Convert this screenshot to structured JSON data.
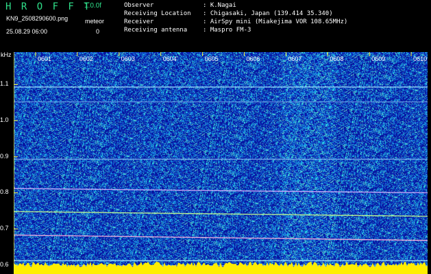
{
  "header": {
    "title": "H R O F F T",
    "version": "1.0.0f",
    "filename": "KN9_2508290600.png",
    "meteor_label": "meteor",
    "datetime": "25.08.29 06:00",
    "meteor_count": "0"
  },
  "info": [
    {
      "label": "Observer",
      "value": ": K.Nagai"
    },
    {
      "label": "Receiving Location",
      "value": ": Chigasaki, Japan (139.414 35.340)"
    },
    {
      "label": "Receiver",
      "value": ": AirSpy mini (Miakejima VOR 108.65MHz)"
    },
    {
      "label": "Receiving antenna",
      "value": ": Maspro FM-3"
    }
  ],
  "y_unit": "kHz",
  "y_ticks": [
    {
      "label": "1.1",
      "value": 1.1
    },
    {
      "label": "1.0",
      "value": 1.0
    },
    {
      "label": "0.9",
      "value": 0.9
    },
    {
      "label": "0.8",
      "value": 0.8
    },
    {
      "label": "0.7",
      "value": 0.7
    },
    {
      "label": "0.6",
      "value": 0.6
    }
  ],
  "x_ticks": [
    "0601",
    "0602",
    "0603",
    "0604",
    "0605",
    "0606",
    "0607",
    "0608",
    "0609",
    "0610"
  ],
  "y_range": [
    0.575,
    1.19
  ],
  "colors": {
    "background": "#000000",
    "title": "#2fe08a",
    "tick": "#ffff33",
    "baseline": "#ffee00",
    "spectrum_low": "#0a14a0",
    "spectrum_high": "#7fffd0"
  },
  "signal_lines": [
    {
      "value_start": 1.093,
      "value_end": 1.093,
      "color": "#9fe3ff"
    },
    {
      "value_start": 1.052,
      "value_end": 1.052,
      "color": "#5f8fe0"
    },
    {
      "value_start": 0.893,
      "value_end": 0.893,
      "color": "#7fb0f0"
    },
    {
      "value_start": 0.812,
      "value_end": 0.8,
      "color": "#d9b0ff"
    },
    {
      "value_start": 0.748,
      "value_end": 0.735,
      "color": "#c8ff90"
    },
    {
      "value_start": 0.683,
      "value_end": 0.668,
      "color": "#ffb0e0"
    },
    {
      "value_start": 0.612,
      "value_end": 0.612,
      "color": "#9fe3ff"
    },
    {
      "value_start": 0.598,
      "value_end": 0.598,
      "color": "#7fb0f0"
    }
  ]
}
